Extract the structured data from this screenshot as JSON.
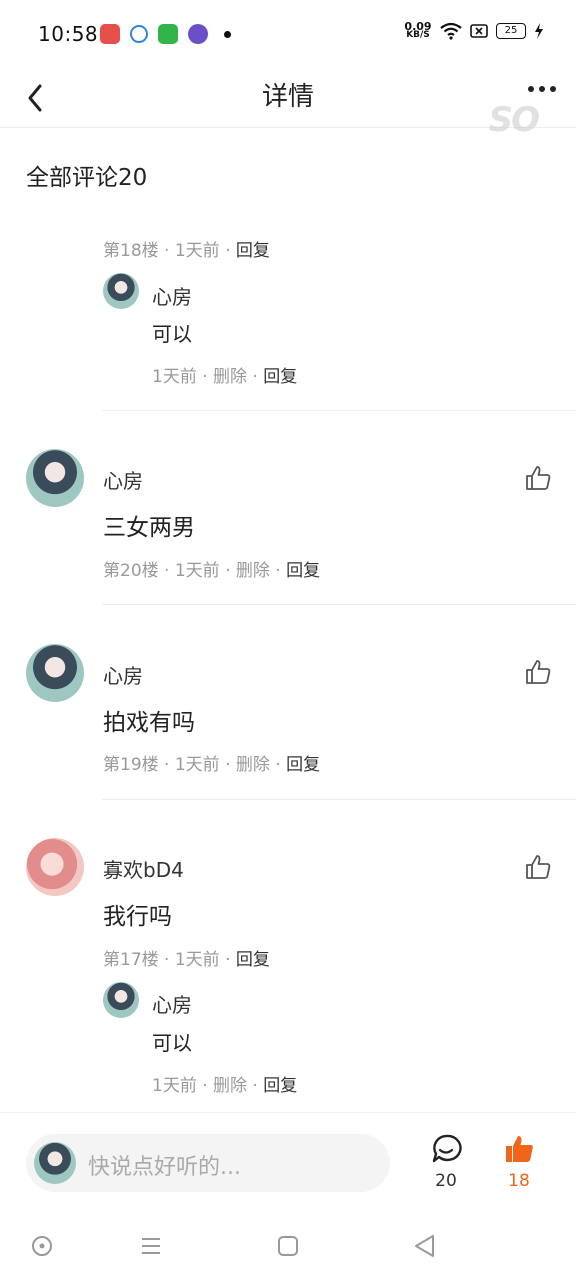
{
  "status_bar": {
    "time": "10:58",
    "net_speed_value": "0.09",
    "net_speed_unit": "KB/S",
    "battery": "25"
  },
  "header": {
    "title": "详情",
    "watermark": "SO"
  },
  "section_title": "全部评论20",
  "comments": [
    {
      "meta": {
        "floor": "第18楼",
        "time": "1天前",
        "reply": "回复"
      },
      "reply": {
        "name": "心房",
        "text": "可以",
        "time": "1天前",
        "delete": "删除",
        "reply": "回复"
      }
    },
    {
      "name": "心房",
      "text": "三女两男",
      "meta": {
        "floor": "第20楼",
        "time": "1天前",
        "delete": "删除",
        "reply": "回复"
      }
    },
    {
      "name": "心房",
      "text": "拍戏有吗",
      "meta": {
        "floor": "第19楼",
        "time": "1天前",
        "delete": "删除",
        "reply": "回复"
      }
    },
    {
      "name": "寡欢bD4",
      "text": "我行吗",
      "meta": {
        "floor": "第17楼",
        "time": "1天前",
        "reply": "回复"
      },
      "reply": {
        "name": "心房",
        "text": "可以",
        "time": "1天前",
        "delete": "删除",
        "reply": "回复"
      }
    }
  ],
  "bottom_bar": {
    "placeholder": "快说点好听的...",
    "comment_count": "20",
    "like_count": "18"
  },
  "colors": {
    "accent": "#f0651a",
    "meta_text": "#999999",
    "divider": "#eeeeee"
  },
  "icons": [
    "back-icon",
    "more-icon",
    "like-icon",
    "comment-icon",
    "thumb-filled-icon",
    "nav-home-icon",
    "nav-menu-icon",
    "nav-square-icon",
    "nav-back-icon"
  ]
}
